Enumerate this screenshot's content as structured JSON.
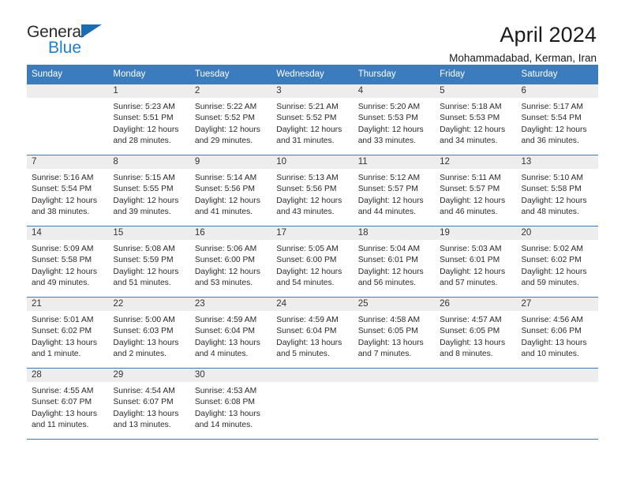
{
  "brand": {
    "name_part1": "General",
    "name_part2": "Blue",
    "triangle_icon": "triangle-icon",
    "color_dark": "#2b2b2b",
    "color_blue": "#1b7fd4"
  },
  "header": {
    "title": "April 2024",
    "subtitle": "Mohammadabad, Kerman, Iran"
  },
  "theme": {
    "header_blue": "#3a7cbe",
    "day_band_gray": "#ededed",
    "text": "#1a1a1a"
  },
  "weekdays": [
    "Sunday",
    "Monday",
    "Tuesday",
    "Wednesday",
    "Thursday",
    "Friday",
    "Saturday"
  ],
  "weeks": [
    [
      {
        "day": "",
        "sunrise": "",
        "sunset": "",
        "daylight1": "",
        "daylight2": "",
        "empty": true
      },
      {
        "day": "1",
        "sunrise": "Sunrise: 5:23 AM",
        "sunset": "Sunset: 5:51 PM",
        "daylight1": "Daylight: 12 hours",
        "daylight2": "and 28 minutes."
      },
      {
        "day": "2",
        "sunrise": "Sunrise: 5:22 AM",
        "sunset": "Sunset: 5:52 PM",
        "daylight1": "Daylight: 12 hours",
        "daylight2": "and 29 minutes."
      },
      {
        "day": "3",
        "sunrise": "Sunrise: 5:21 AM",
        "sunset": "Sunset: 5:52 PM",
        "daylight1": "Daylight: 12 hours",
        "daylight2": "and 31 minutes."
      },
      {
        "day": "4",
        "sunrise": "Sunrise: 5:20 AM",
        "sunset": "Sunset: 5:53 PM",
        "daylight1": "Daylight: 12 hours",
        "daylight2": "and 33 minutes."
      },
      {
        "day": "5",
        "sunrise": "Sunrise: 5:18 AM",
        "sunset": "Sunset: 5:53 PM",
        "daylight1": "Daylight: 12 hours",
        "daylight2": "and 34 minutes."
      },
      {
        "day": "6",
        "sunrise": "Sunrise: 5:17 AM",
        "sunset": "Sunset: 5:54 PM",
        "daylight1": "Daylight: 12 hours",
        "daylight2": "and 36 minutes."
      }
    ],
    [
      {
        "day": "7",
        "sunrise": "Sunrise: 5:16 AM",
        "sunset": "Sunset: 5:54 PM",
        "daylight1": "Daylight: 12 hours",
        "daylight2": "and 38 minutes."
      },
      {
        "day": "8",
        "sunrise": "Sunrise: 5:15 AM",
        "sunset": "Sunset: 5:55 PM",
        "daylight1": "Daylight: 12 hours",
        "daylight2": "and 39 minutes."
      },
      {
        "day": "9",
        "sunrise": "Sunrise: 5:14 AM",
        "sunset": "Sunset: 5:56 PM",
        "daylight1": "Daylight: 12 hours",
        "daylight2": "and 41 minutes."
      },
      {
        "day": "10",
        "sunrise": "Sunrise: 5:13 AM",
        "sunset": "Sunset: 5:56 PM",
        "daylight1": "Daylight: 12 hours",
        "daylight2": "and 43 minutes."
      },
      {
        "day": "11",
        "sunrise": "Sunrise: 5:12 AM",
        "sunset": "Sunset: 5:57 PM",
        "daylight1": "Daylight: 12 hours",
        "daylight2": "and 44 minutes."
      },
      {
        "day": "12",
        "sunrise": "Sunrise: 5:11 AM",
        "sunset": "Sunset: 5:57 PM",
        "daylight1": "Daylight: 12 hours",
        "daylight2": "and 46 minutes."
      },
      {
        "day": "13",
        "sunrise": "Sunrise: 5:10 AM",
        "sunset": "Sunset: 5:58 PM",
        "daylight1": "Daylight: 12 hours",
        "daylight2": "and 48 minutes."
      }
    ],
    [
      {
        "day": "14",
        "sunrise": "Sunrise: 5:09 AM",
        "sunset": "Sunset: 5:58 PM",
        "daylight1": "Daylight: 12 hours",
        "daylight2": "and 49 minutes."
      },
      {
        "day": "15",
        "sunrise": "Sunrise: 5:08 AM",
        "sunset": "Sunset: 5:59 PM",
        "daylight1": "Daylight: 12 hours",
        "daylight2": "and 51 minutes."
      },
      {
        "day": "16",
        "sunrise": "Sunrise: 5:06 AM",
        "sunset": "Sunset: 6:00 PM",
        "daylight1": "Daylight: 12 hours",
        "daylight2": "and 53 minutes."
      },
      {
        "day": "17",
        "sunrise": "Sunrise: 5:05 AM",
        "sunset": "Sunset: 6:00 PM",
        "daylight1": "Daylight: 12 hours",
        "daylight2": "and 54 minutes."
      },
      {
        "day": "18",
        "sunrise": "Sunrise: 5:04 AM",
        "sunset": "Sunset: 6:01 PM",
        "daylight1": "Daylight: 12 hours",
        "daylight2": "and 56 minutes."
      },
      {
        "day": "19",
        "sunrise": "Sunrise: 5:03 AM",
        "sunset": "Sunset: 6:01 PM",
        "daylight1": "Daylight: 12 hours",
        "daylight2": "and 57 minutes."
      },
      {
        "day": "20",
        "sunrise": "Sunrise: 5:02 AM",
        "sunset": "Sunset: 6:02 PM",
        "daylight1": "Daylight: 12 hours",
        "daylight2": "and 59 minutes."
      }
    ],
    [
      {
        "day": "21",
        "sunrise": "Sunrise: 5:01 AM",
        "sunset": "Sunset: 6:02 PM",
        "daylight1": "Daylight: 13 hours",
        "daylight2": "and 1 minute."
      },
      {
        "day": "22",
        "sunrise": "Sunrise: 5:00 AM",
        "sunset": "Sunset: 6:03 PM",
        "daylight1": "Daylight: 13 hours",
        "daylight2": "and 2 minutes."
      },
      {
        "day": "23",
        "sunrise": "Sunrise: 4:59 AM",
        "sunset": "Sunset: 6:04 PM",
        "daylight1": "Daylight: 13 hours",
        "daylight2": "and 4 minutes."
      },
      {
        "day": "24",
        "sunrise": "Sunrise: 4:59 AM",
        "sunset": "Sunset: 6:04 PM",
        "daylight1": "Daylight: 13 hours",
        "daylight2": "and 5 minutes."
      },
      {
        "day": "25",
        "sunrise": "Sunrise: 4:58 AM",
        "sunset": "Sunset: 6:05 PM",
        "daylight1": "Daylight: 13 hours",
        "daylight2": "and 7 minutes."
      },
      {
        "day": "26",
        "sunrise": "Sunrise: 4:57 AM",
        "sunset": "Sunset: 6:05 PM",
        "daylight1": "Daylight: 13 hours",
        "daylight2": "and 8 minutes."
      },
      {
        "day": "27",
        "sunrise": "Sunrise: 4:56 AM",
        "sunset": "Sunset: 6:06 PM",
        "daylight1": "Daylight: 13 hours",
        "daylight2": "and 10 minutes."
      }
    ],
    [
      {
        "day": "28",
        "sunrise": "Sunrise: 4:55 AM",
        "sunset": "Sunset: 6:07 PM",
        "daylight1": "Daylight: 13 hours",
        "daylight2": "and 11 minutes."
      },
      {
        "day": "29",
        "sunrise": "Sunrise: 4:54 AM",
        "sunset": "Sunset: 6:07 PM",
        "daylight1": "Daylight: 13 hours",
        "daylight2": "and 13 minutes."
      },
      {
        "day": "30",
        "sunrise": "Sunrise: 4:53 AM",
        "sunset": "Sunset: 6:08 PM",
        "daylight1": "Daylight: 13 hours",
        "daylight2": "and 14 minutes."
      },
      {
        "day": "",
        "sunrise": "",
        "sunset": "",
        "daylight1": "",
        "daylight2": "",
        "empty": true
      },
      {
        "day": "",
        "sunrise": "",
        "sunset": "",
        "daylight1": "",
        "daylight2": "",
        "empty": true
      },
      {
        "day": "",
        "sunrise": "",
        "sunset": "",
        "daylight1": "",
        "daylight2": "",
        "empty": true
      },
      {
        "day": "",
        "sunrise": "",
        "sunset": "",
        "daylight1": "",
        "daylight2": "",
        "empty": true
      }
    ]
  ]
}
